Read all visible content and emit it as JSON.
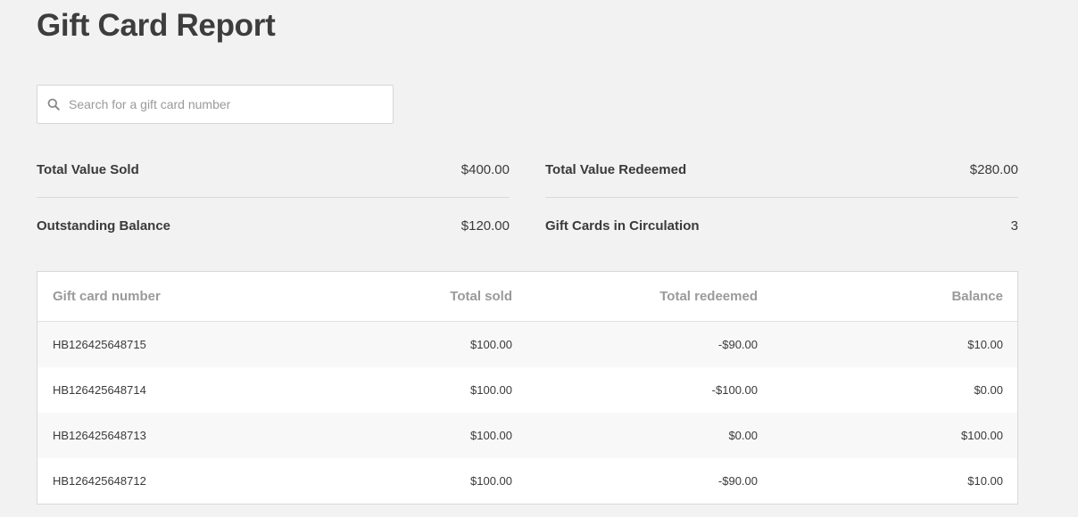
{
  "page": {
    "title": "Gift Card Report"
  },
  "search": {
    "placeholder": "Search for a gift card number",
    "value": "",
    "icon": "search-icon"
  },
  "stats": {
    "total_value_sold": {
      "label": "Total Value Sold",
      "value": "$400.00"
    },
    "total_value_redeemed": {
      "label": "Total Value Redeemed",
      "value": "$280.00"
    },
    "outstanding_balance": {
      "label": "Outstanding Balance",
      "value": "$120.00"
    },
    "gift_cards_in_circulation": {
      "label": "Gift Cards in Circulation",
      "value": "3"
    }
  },
  "table": {
    "columns": [
      "Gift card number",
      "Total sold",
      "Total redeemed",
      "Balance"
    ],
    "rows": [
      [
        "HB126425648715",
        "$100.00",
        "-$90.00",
        "$10.00"
      ],
      [
        "HB126425648714",
        "$100.00",
        "-$100.00",
        "$0.00"
      ],
      [
        "HB126425648713",
        "$100.00",
        "$0.00",
        "$100.00"
      ],
      [
        "HB126425648712",
        "$100.00",
        "-$90.00",
        "$10.00"
      ]
    ]
  },
  "colors": {
    "background": "#f2f2f2",
    "text": "#3a3a3a",
    "muted_text": "#9a9a9a",
    "border": "#d9d9d9",
    "row_alt": "#f8f8f8"
  }
}
